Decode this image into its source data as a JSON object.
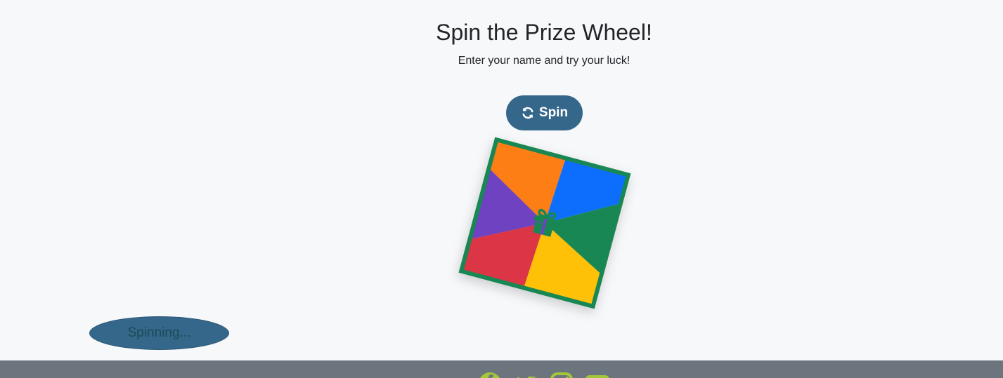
{
  "header": {
    "title": "Spin the Prize Wheel!",
    "subtitle": "Enter your name and try your luck!"
  },
  "spin_button": {
    "label": "Spin",
    "icon": "sync-icon"
  },
  "wheel": {
    "center_icon": "gift-icon",
    "border_color": "#198754",
    "segments": [
      {
        "color": "#fd7e14"
      },
      {
        "color": "#0d6efd"
      },
      {
        "color": "#198754"
      },
      {
        "color": "#ffc107"
      },
      {
        "color": "#dc3545"
      },
      {
        "color": "#6f42c1"
      }
    ]
  },
  "status": {
    "text": "Spinning..."
  },
  "footer": {
    "background": "#6c757d",
    "icon_color": "#a4c639",
    "social_icons": [
      "facebook-icon",
      "twitter-icon",
      "instagram-icon",
      "youtube-icon"
    ]
  },
  "colors": {
    "accent": "#35678a",
    "page_background": "#f7f8fa"
  }
}
